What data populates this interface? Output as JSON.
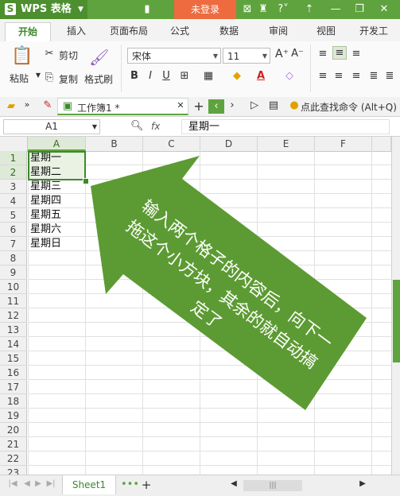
{
  "app": {
    "name": "WPS 表格",
    "logo_letter": "S",
    "login_label": "未登录"
  },
  "ribbon_tabs": [
    "开始",
    "插入",
    "页面布局",
    "公式",
    "数据",
    "审阅",
    "视图",
    "开发工"
  ],
  "toolbar": {
    "cut": "剪切",
    "paste": "粘贴",
    "copy": "复制",
    "format_painter": "格式刷",
    "font_name": "宋体",
    "font_size": "11",
    "bold": "B",
    "italic": "I",
    "underline": "U"
  },
  "doc_bar": {
    "doc_tab": "工作簿1 *",
    "search_hint": "点此查找命令 (Alt+Q)"
  },
  "formula_bar": {
    "cell_ref": "A1",
    "fx_label": "fx",
    "value": "星期一"
  },
  "grid": {
    "columns": [
      "A",
      "B",
      "C",
      "D",
      "E",
      "F"
    ],
    "rows": [
      "1",
      "2",
      "3",
      "4",
      "5",
      "6",
      "7",
      "8",
      "9",
      "10",
      "11",
      "12",
      "13",
      "14",
      "15",
      "16",
      "17",
      "18",
      "19",
      "20",
      "21",
      "22",
      "23"
    ],
    "cells_a": [
      "星期一",
      "星期二",
      "星期三",
      "星期四",
      "星期五",
      "星期六",
      "星期日"
    ]
  },
  "callout": {
    "text": "输入两个格子的内容后，向下一拖这个小方块，其余的就自动搞定了"
  },
  "sheets": [
    "Sheet1"
  ],
  "colors": {
    "brand_green": "#5fa33e",
    "login_orange": "#ed6b3e",
    "callout_green": "#5c9b33"
  }
}
